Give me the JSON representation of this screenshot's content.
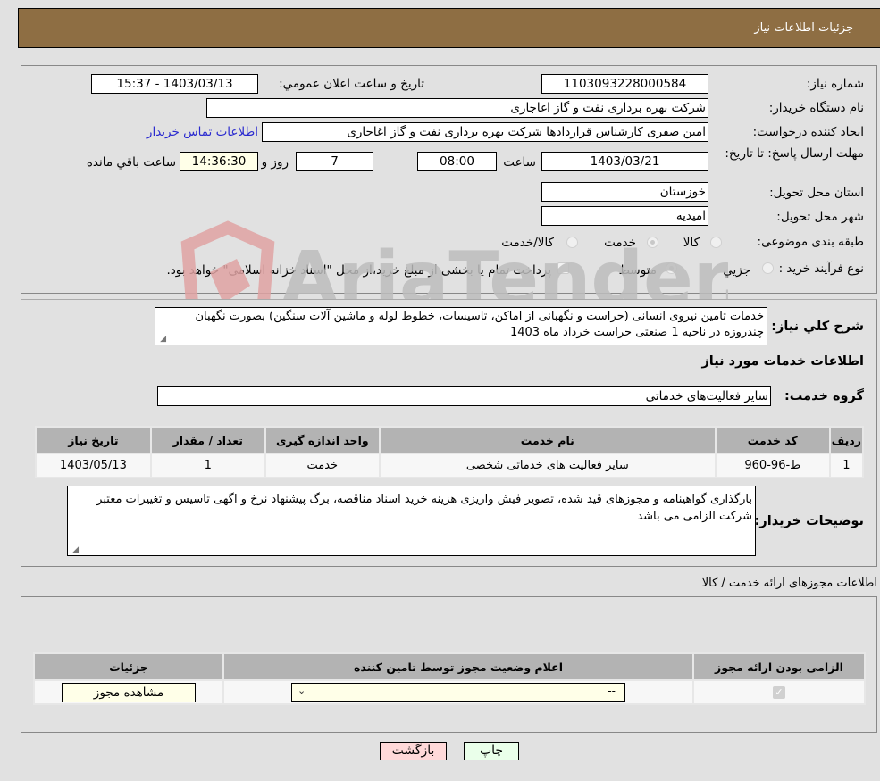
{
  "header": {
    "title": "جزئیات اطلاعات نیاز"
  },
  "details": {
    "need_number_label": "شماره نیاز:",
    "need_number": "1103093228000584",
    "announce_label": "تاریخ و ساعت اعلان عمومي:",
    "announce_value": "1403/03/13 - 15:37",
    "buyer_org_label": "نام دستگاه خریدار:",
    "buyer_org": "شرکت بهره برداری نفت و گاز اغاجاری",
    "creator_label": "ایجاد کننده درخواست:",
    "creator": "امین صفری کارشناس قراردادها شرکت بهره برداری نفت و گاز اغاجاری",
    "contact_link": "اطلاعات تماس خریدار",
    "deadline_label": "مهلت ارسال پاسخ: تا تاریخ:",
    "deadline_date": "1403/03/21",
    "time_label": "ساعت",
    "deadline_time": "08:00",
    "days_value": "7",
    "days_label": "روز و",
    "remaining_time": "14:36:30",
    "remaining_label": "ساعت باقي مانده",
    "province_label": "استان محل تحویل:",
    "province": "خوزستان",
    "city_label": "شهر محل تحویل:",
    "city": "امیدیه",
    "category_label": "طبقه بندی موضوعی:",
    "category_options": [
      "کالا",
      "خدمت",
      "کالا/خدمت"
    ],
    "category_selected": "خدمت",
    "process_label": "نوع فرآیند خرید :",
    "process_options": [
      "جزيي",
      "متوسط"
    ],
    "process_selected": "متوسط",
    "treasury_note": "پرداخت تمام یا بخشی از مبلغ خرید،از محل \"اسناد خزانه اسلامی\" خواهد بود."
  },
  "description": {
    "label": "شرح کلي نياز:",
    "text": "خدمات تامین نیروی انسانی (حراست و نگهبانی از اماکن، تاسیسات، خطوط لوله و ماشین آلات سنگین) بصورت نگهبان چندروزه در ناحیه 1 صنعتی حراست خرداد ماه 1403"
  },
  "services": {
    "section_title": "اطلاعات خدمات مورد نیاز",
    "group_label": "گروه خدمت:",
    "group_value": "سایر فعالیت‌های خدماتی",
    "table": {
      "headers": [
        "ردیف",
        "کد خدمت",
        "نام خدمت",
        "واحد اندازه گیری",
        "تعداد / مقدار",
        "تاریخ نیاز"
      ],
      "rows": [
        [
          "1",
          "ط-96-960",
          "سایر فعالیت های خدماتی شخصی",
          "خدمت",
          "1",
          "1403/05/13"
        ]
      ]
    }
  },
  "buyer_notes": {
    "label": "توضیحات خریدار:",
    "text": "بارگذاری گواهینامه و مجوزهای قید شده، تصویر فیش واریزی هزینه خرید اسناد مناقصه، برگ پیشنهاد نرخ و اگهی تاسیس و تغییرات معتبر شرکت الزامی می باشد"
  },
  "permits": {
    "section_title": "اطلاعات مجوزهای ارائه خدمت / کالا",
    "headers": [
      "الزامی بودن ارائه مجوز",
      "اعلام وضعیت مجوز توسط تامین کننده",
      "جزئیات"
    ],
    "row": {
      "required_checked": true,
      "status_value": "--",
      "details_button": "مشاهده مجوز"
    }
  },
  "footer": {
    "print_button": "چاپ",
    "back_button": "بازگشت"
  },
  "watermark": {
    "text": "AriaTender.neT"
  }
}
